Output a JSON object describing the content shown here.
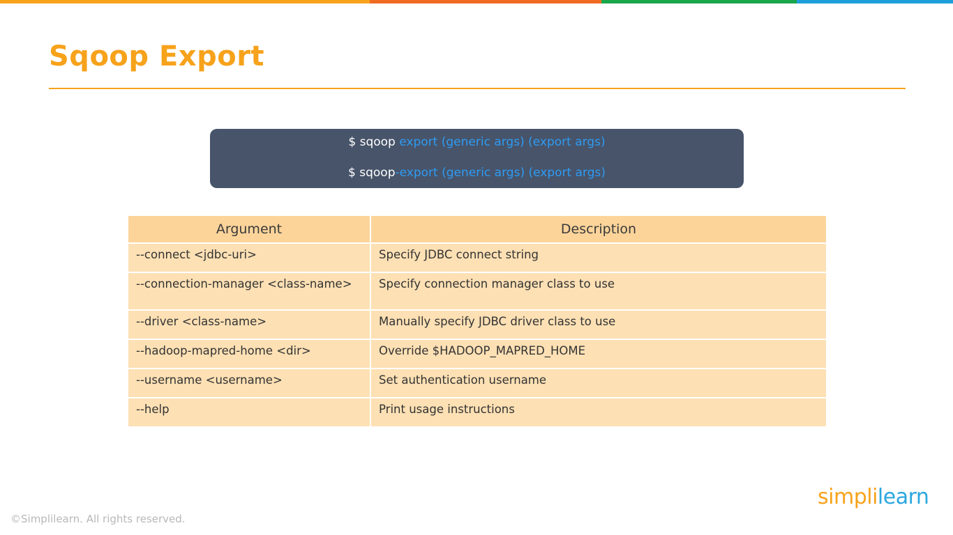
{
  "brand_colors": {
    "bar": [
      "#f7a21b",
      "#f06a22",
      "#1aa64a",
      "#1e9fdb"
    ],
    "title": "#f7a21b",
    "command_box": "#47546a",
    "command_highlight": "#2f9bf2",
    "table_header": "#fcd49a",
    "table_cell": "#fde0b4"
  },
  "slide": {
    "title": "Sqoop Export"
  },
  "commands": [
    {
      "prefix": "$ sqoop",
      "args": " export (generic args) (export args)"
    },
    {
      "prefix": "$ sqoop",
      "args": "-export (generic args) (export args)"
    }
  ],
  "table": {
    "headers": [
      "Argument",
      "Description"
    ],
    "rows": [
      {
        "argument": "--connect <jdbc-uri>",
        "description": "Specify JDBC connect string"
      },
      {
        "argument": "--connection-manager <class-name>",
        "description": "Specify connection manager class to use"
      },
      {
        "argument": "--driver <class-name>",
        "description": "Manually specify JDBC driver class to use"
      },
      {
        "argument": "--hadoop-mapred-home <dir>",
        "description": "Override $HADOOP_MAPRED_HOME"
      },
      {
        "argument": "--username <username>",
        "description": "Set authentication username"
      },
      {
        "argument": "--help",
        "description": "Print usage instructions"
      }
    ]
  },
  "footer": {
    "copyright": "©Simplilearn. All rights reserved."
  },
  "logo": {
    "part1": "simpl",
    "separator": "i",
    "part2": "learn"
  }
}
